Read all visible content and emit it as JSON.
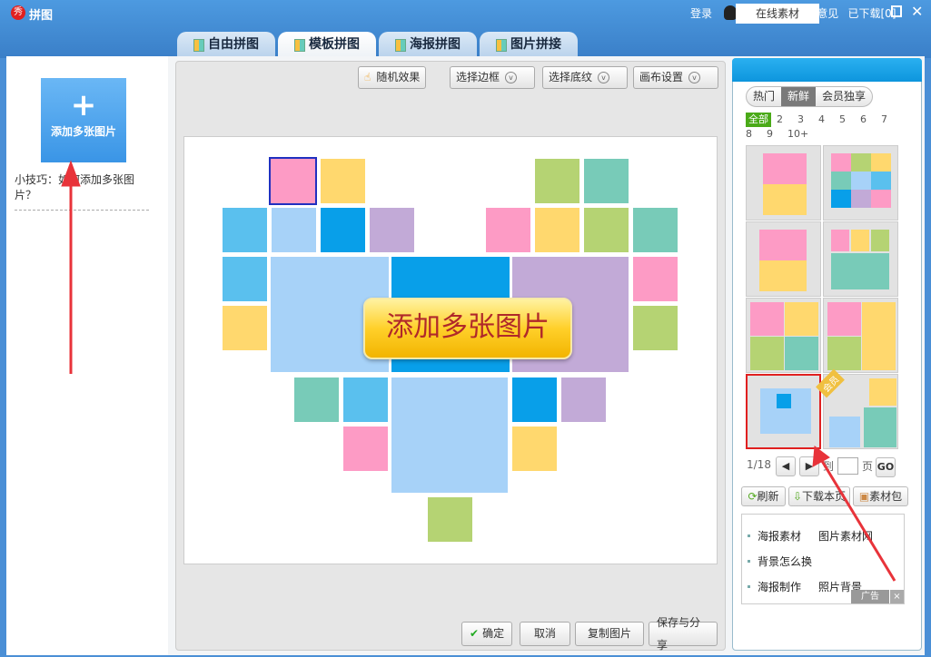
{
  "window": {
    "title": "拼图",
    "login": "登录",
    "feedback": "提意见",
    "logo_text": "秀"
  },
  "tabs": [
    {
      "label": "自由拼图"
    },
    {
      "label": "模板拼图"
    },
    {
      "label": "海报拼图"
    },
    {
      "label": "图片拼接"
    }
  ],
  "left": {
    "add_label": "添加多张图片",
    "add_symbol": "+",
    "tip": "小技巧：如何添加多张图片？"
  },
  "toolbar": {
    "random": "随机效果",
    "border": "选择边框",
    "texture": "选择底纹",
    "canvas": "画布设置"
  },
  "canvas": {
    "center_button": "添加多张图片"
  },
  "bottom": {
    "confirm": "确定",
    "cancel": "取消",
    "copy": "复制图片",
    "save": "保存与分享"
  },
  "right": {
    "tab_online": "在线素材",
    "tab_downloaded": "已下载[0]",
    "filters": [
      "热门",
      "新鲜",
      "会员独享"
    ],
    "counts": [
      "全部",
      "2",
      "3",
      "4",
      "5",
      "6",
      "7",
      "8",
      "9",
      "10+"
    ],
    "member_badge": "会员",
    "page": "1/18",
    "goto": "到",
    "page_unit": "页",
    "go": "GO",
    "refresh": "刷新",
    "download_page": "下载本页",
    "pack": "素材包",
    "ads": [
      "海报素材",
      "图片素材网",
      "背景怎么换",
      "海报制作",
      "照片背景"
    ],
    "ad_tag": "广告",
    "ad_close": "×"
  }
}
